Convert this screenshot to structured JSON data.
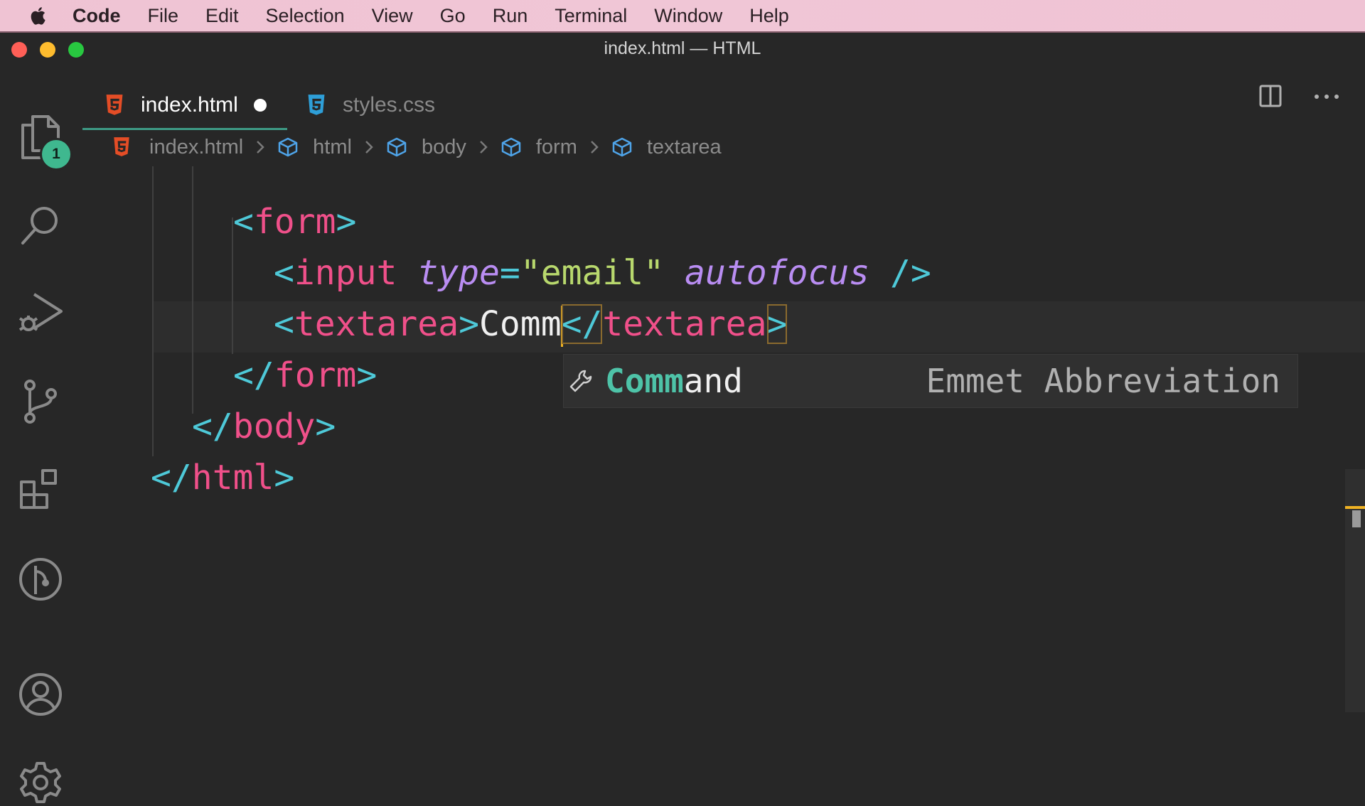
{
  "menubar": {
    "app": "Code",
    "items": [
      "File",
      "Edit",
      "Selection",
      "View",
      "Go",
      "Run",
      "Terminal",
      "Window",
      "Help"
    ]
  },
  "window": {
    "title": "index.html — HTML"
  },
  "activity_bar": {
    "icons": [
      "files-icon",
      "search-icon",
      "run-debug-icon",
      "source-control-icon",
      "extensions-icon",
      "git-graph-icon",
      "account-icon",
      "gear-icon"
    ],
    "explorer_badge": "1"
  },
  "tabs": [
    {
      "label": "index.html",
      "icon": "html5-icon",
      "active": true,
      "dirty": true
    },
    {
      "label": "styles.css",
      "icon": "css3-icon",
      "active": false,
      "dirty": false
    }
  ],
  "breadcrumb": [
    "index.html",
    "html",
    "body",
    "form",
    "textarea"
  ],
  "code": {
    "line1": {
      "open": "<",
      "tag": "form",
      "close": ">"
    },
    "line2": {
      "open": "<",
      "tag": "input",
      "attr1": "type",
      "eq": "=",
      "str": "\"email\"",
      "attr2": "autofocus",
      "close": "/>"
    },
    "line3": {
      "open": "<",
      "tag": "textarea",
      "mid": ">",
      "text": "Comm",
      "open2": "</",
      "tag2": "textarea",
      "close": ">"
    },
    "line4": {
      "open": "</",
      "tag": "form",
      "close": ">"
    },
    "line5": {
      "open": "</",
      "tag": "body",
      "close": ">"
    },
    "line6": {
      "open": "</",
      "tag": "html",
      "close": ">"
    }
  },
  "suggestion": {
    "icon": "wrench-icon",
    "match": "Comm",
    "rest": "and",
    "detail": "Emmet Abbreviation"
  },
  "colors": {
    "tag": "#f0508a",
    "punctuation": "#4ec9d8",
    "attribute": "#b98df2",
    "string": "#b8d86d",
    "cursor": "#f0b323",
    "badge": "#3fb88f"
  }
}
